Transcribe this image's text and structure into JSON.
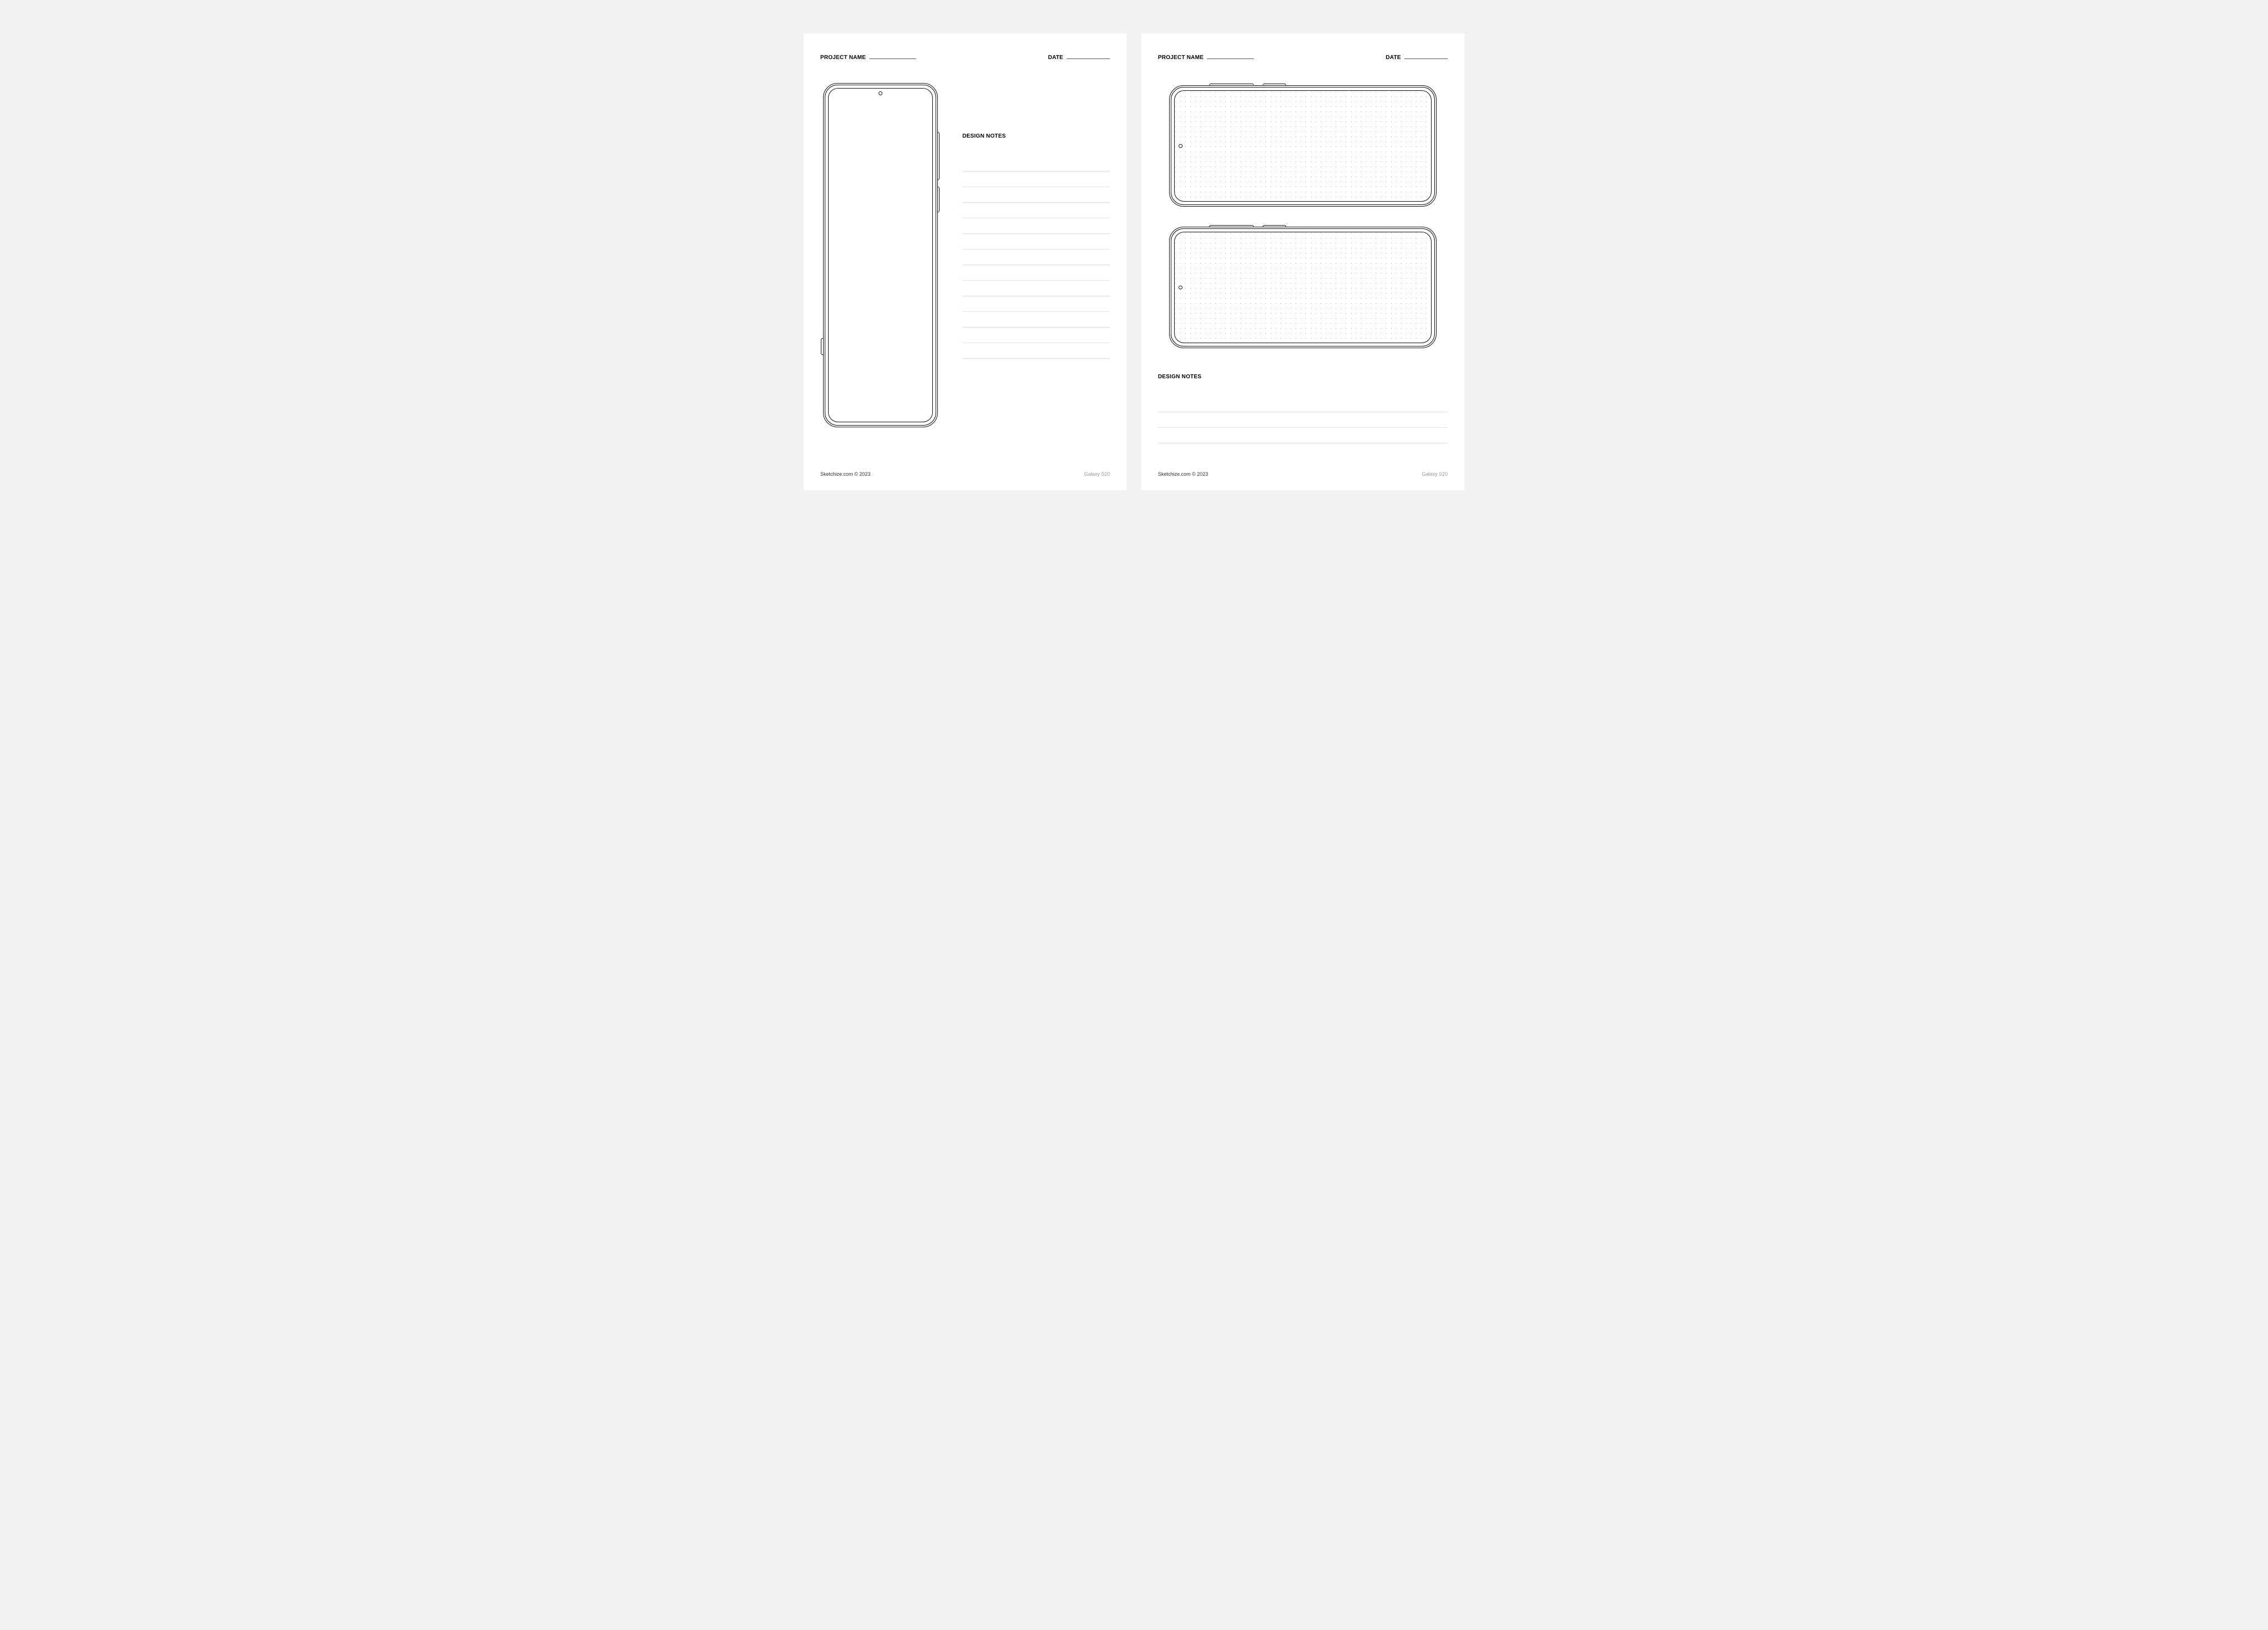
{
  "labels": {
    "project_name": "PROJECT NAME",
    "date": "DATE",
    "design_notes": "DESIGN NOTES"
  },
  "footer": {
    "brand": "Sketchize.com © 2023",
    "device": "Galaxy S20"
  },
  "portrait_sheet": {
    "note_line_count": 13
  },
  "landscape_sheet": {
    "device_count": 2,
    "note_line_count": 3
  }
}
